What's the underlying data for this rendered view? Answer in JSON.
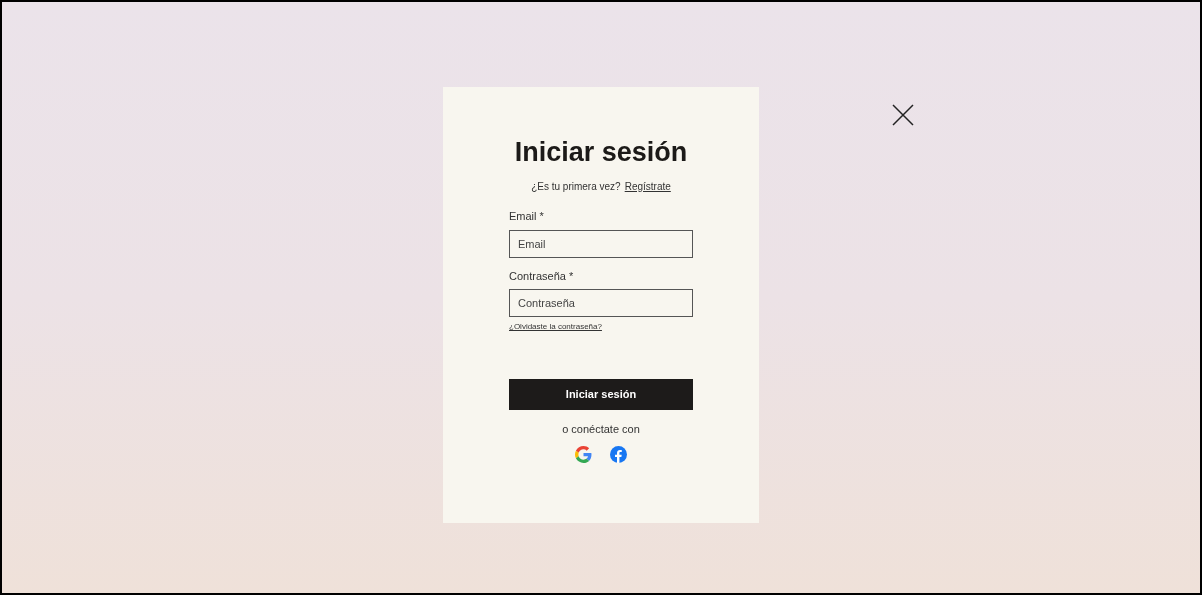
{
  "dialog": {
    "title": "Iniciar sesión",
    "signup_prompt": "¿Es tu primera vez?",
    "signup_link": "Regístrate",
    "fields": [
      {
        "label": "Email *",
        "placeholder": "Email"
      },
      {
        "label": "Contraseña *",
        "placeholder": "Contraseña"
      }
    ],
    "forgot_link": "¿Olvidaste la contraseña?",
    "submit": "Iniciar sesión",
    "social_prompt": "o conéctate con"
  }
}
